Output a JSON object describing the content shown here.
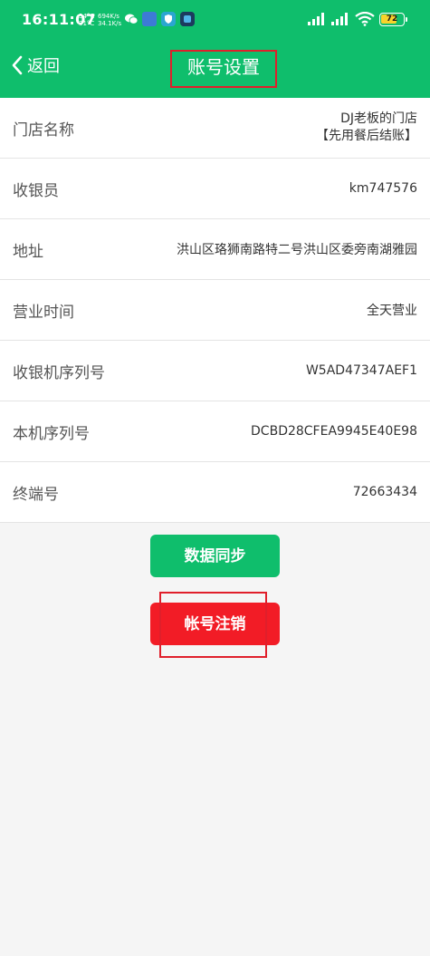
{
  "status_bar": {
    "time": "16:11:07",
    "temp_1": "54°C",
    "temp_2": "31°C",
    "speed_up": "694K/s",
    "speed_down": "34.1K/s",
    "battery": "72",
    "battery_level": 0.72,
    "icons": [
      "wechat-icon",
      "app-icon",
      "shield-app-icon",
      "app-icon",
      "signal-icon",
      "signal-icon",
      "wifi-icon",
      "battery-icon"
    ]
  },
  "header": {
    "back_label": "返回",
    "title": "账号设置"
  },
  "colors": {
    "brand_green": "#0fbe6c",
    "danger_red": "#f21c26",
    "highlight_red": "#e01f2b"
  },
  "rows": [
    {
      "label": "门店名称",
      "value_line1": "DJ老板的门店",
      "value_line2": "【先用餐后结账】"
    },
    {
      "label": "收银员",
      "value": "km747576"
    },
    {
      "label": "地址",
      "value": "洪山区珞狮南路特二号洪山区委旁南湖雅园"
    },
    {
      "label": "营业时间",
      "value": "全天营业"
    },
    {
      "label": "收银机序列号",
      "value": "W5AD47347AEF1"
    },
    {
      "label": "本机序列号",
      "value": "DCBD28CFEA9945E40E98"
    },
    {
      "label": "终端号",
      "value": "72663434"
    }
  ],
  "buttons": {
    "sync": "数据同步",
    "logout": "帐号注销"
  }
}
